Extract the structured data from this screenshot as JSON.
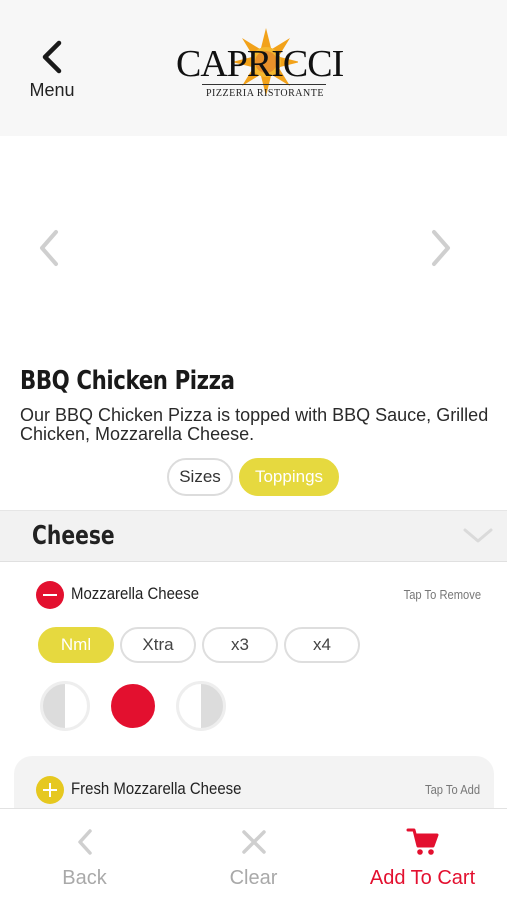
{
  "header": {
    "menu_label": "Menu",
    "logo_text": "CAPRICCI",
    "logo_subtitle": "PIZZERIA  RISTORANTE"
  },
  "product": {
    "title": "BBQ Chicken Pizza",
    "description": "Our BBQ Chicken Pizza is topped with BBQ Sauce, Grilled Chicken, Mozzarella Cheese."
  },
  "tabs": [
    {
      "label": "Sizes",
      "active": false
    },
    {
      "label": "Toppings",
      "active": true
    }
  ],
  "section": {
    "title": "Cheese"
  },
  "toppings": [
    {
      "name": "Mozzarella Cheese",
      "note": "Tap To Remove",
      "selected": true,
      "quantities": [
        "Nml",
        "Xtra",
        "x3",
        "x4"
      ],
      "selected_quantity": "Nml",
      "portion_selected": "whole"
    },
    {
      "name": "Fresh Mozzarella Cheese",
      "note": "Tap To Add",
      "selected": false
    }
  ],
  "bottom_bar": {
    "back_label": "Back",
    "clear_label": "Clear",
    "cart_label": "Add To Cart"
  },
  "colors": {
    "accent_yellow": "#e6d93f",
    "accent_red": "#e3102f",
    "muted_gray": "#a9a9a9"
  },
  "icons": {
    "menu": "chevron-left-icon",
    "gallery_prev": "chevron-left-icon",
    "gallery_next": "chevron-right-icon",
    "section_toggle": "chevron-down-icon",
    "remove": "minus-circle-icon",
    "add": "plus-circle-icon",
    "back": "chevron-left-icon",
    "clear": "close-icon",
    "cart": "cart-icon"
  }
}
